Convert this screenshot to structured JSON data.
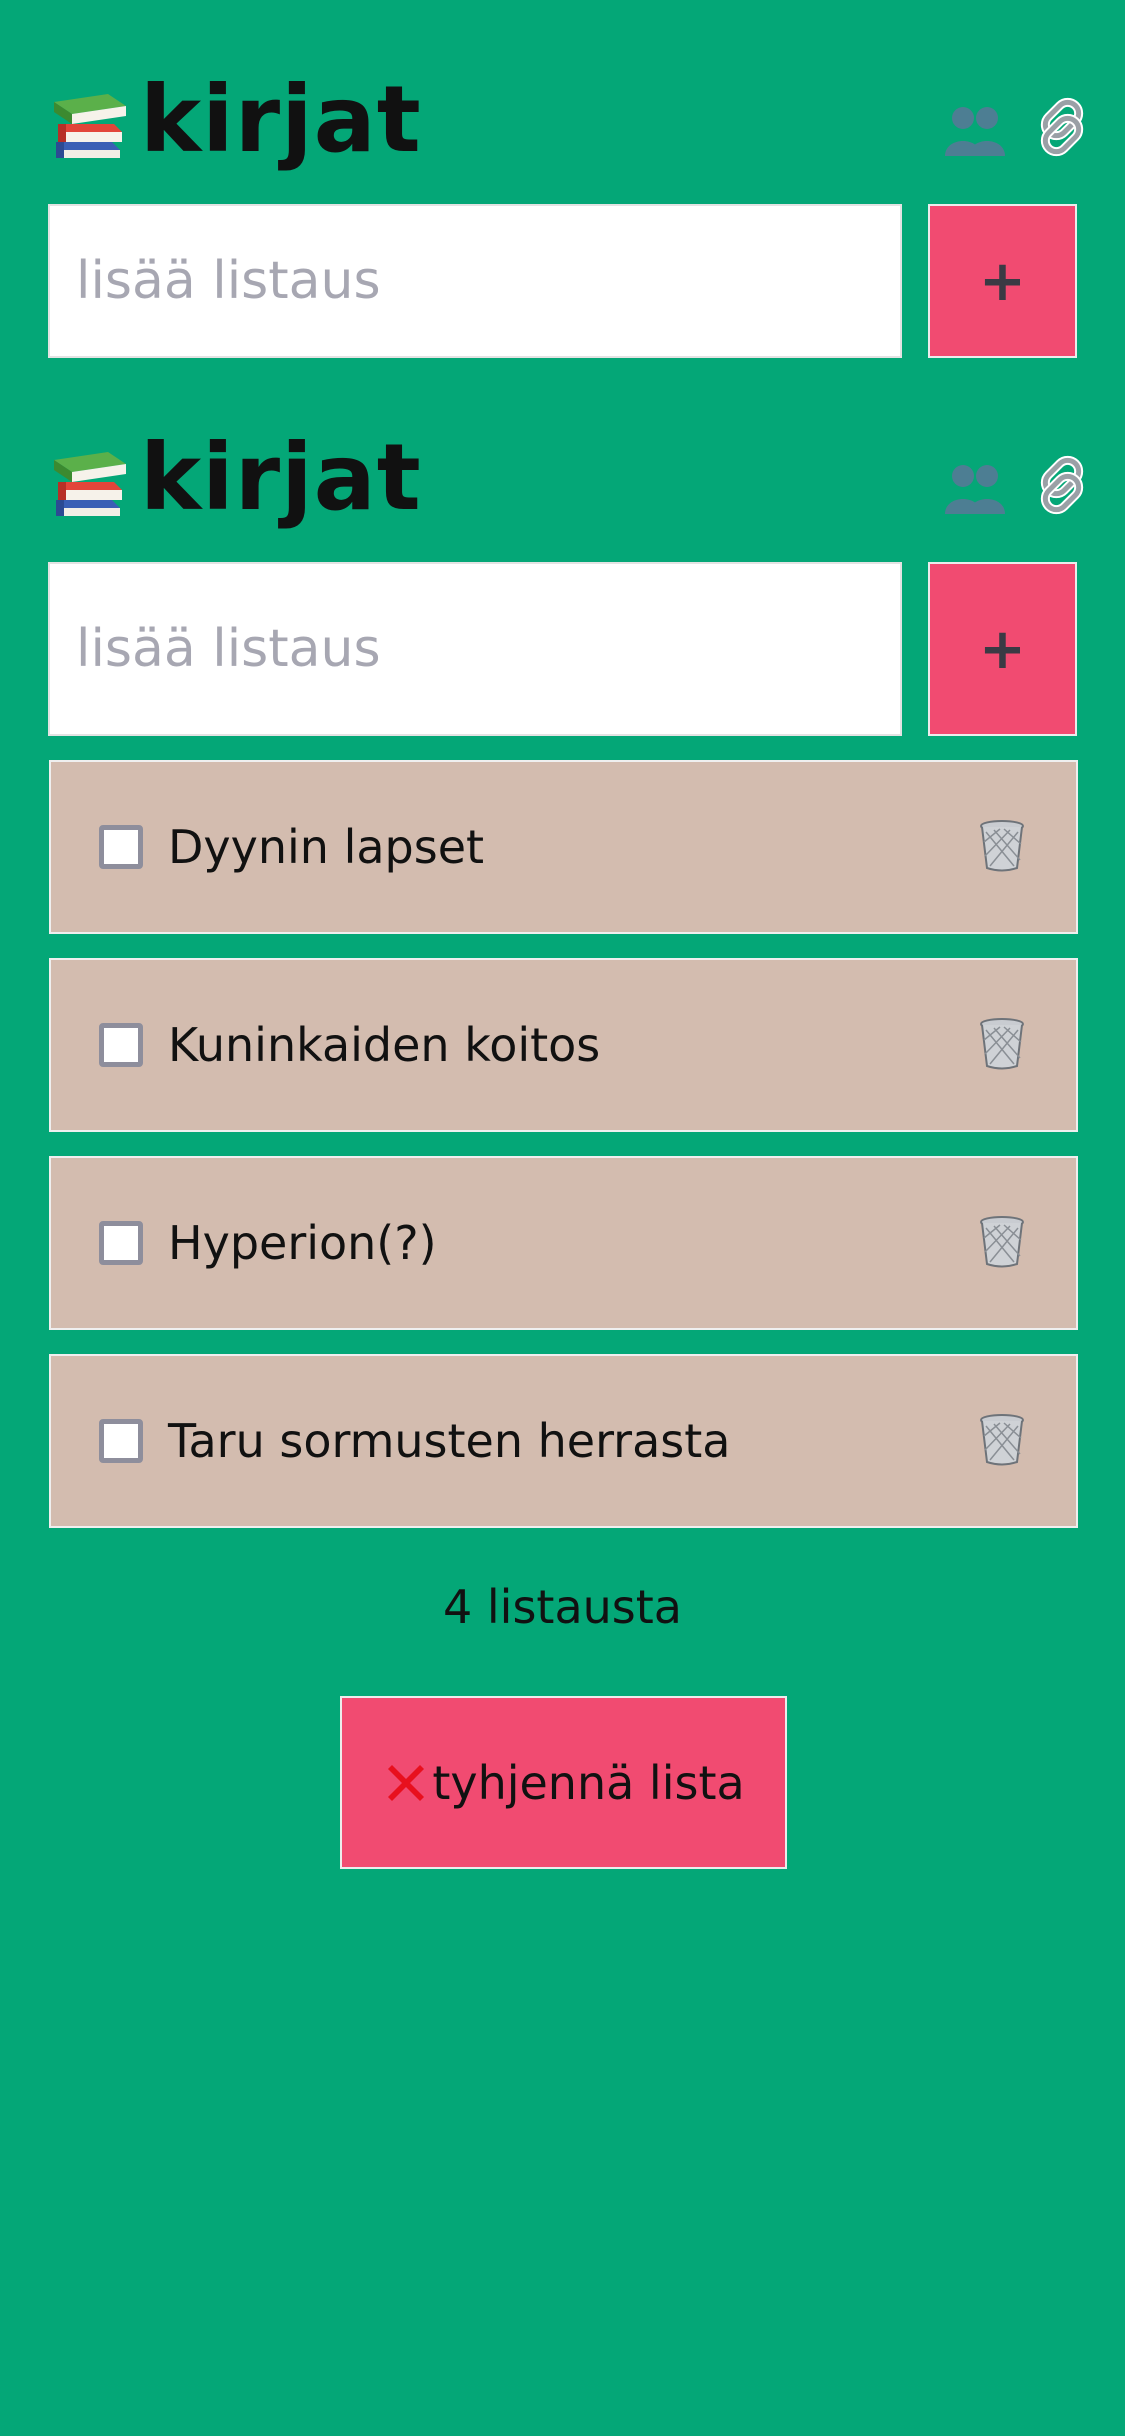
{
  "header": {
    "title": "kirjat",
    "icons": [
      "books-icon",
      "users-icon",
      "link-icon"
    ]
  },
  "add_form": {
    "placeholder": "lisää listaus",
    "button_label": "+"
  },
  "items": [
    {
      "label": "Dyynin lapset",
      "checked": false
    },
    {
      "label": "Kuninkaiden koitos",
      "checked": false
    },
    {
      "label": "Hyperion(?)",
      "checked": false
    },
    {
      "label": "Taru sormusten herrasta",
      "checked": false
    }
  ],
  "footer": {
    "count_text": "4 listausta",
    "clear_label": "tyhjennä lista",
    "clear_icon": "cross-icon"
  },
  "colors": {
    "background": "#04a777",
    "accent": "#f14b71",
    "item_background": "#d3bcaf"
  }
}
